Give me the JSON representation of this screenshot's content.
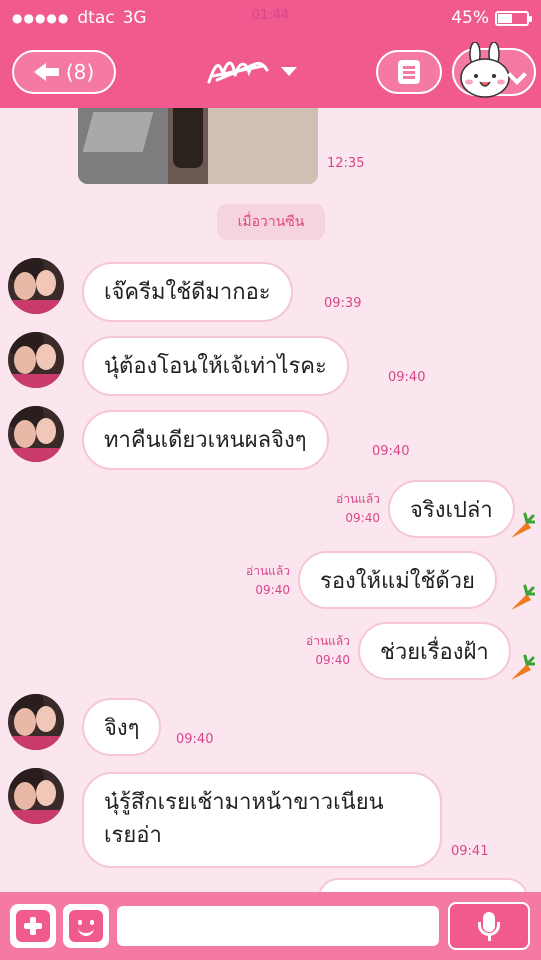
{
  "status_bar": {
    "carrier": "dtac",
    "network": "3G",
    "time": "01:44",
    "battery_percent": "45%",
    "battery_level": 0.45
  },
  "header": {
    "unread_count": "(8)",
    "icons": [
      "back-arrow-icon",
      "menu-icon",
      "bunny-avatar-icon"
    ]
  },
  "photo_message": {
    "time": "12:35"
  },
  "date_separator": "เมื่อวานซืน",
  "read_label": "อ่านแล้ว",
  "messages": [
    {
      "direction": "in",
      "text": "เจ๊ครีมใช้ดีมากอะ",
      "time": "09:39"
    },
    {
      "direction": "in",
      "text": "นุ๋ต้องโอนให้เจ้เท่าไรคะ",
      "time": "09:40"
    },
    {
      "direction": "in",
      "text": "ทาคืนเดียวเหนผลจิงๆ",
      "time": "09:40"
    },
    {
      "direction": "out",
      "text": "จริงเปล่า",
      "time": "09:40"
    },
    {
      "direction": "out",
      "text": "รองให้แม่ใช้ด้วย",
      "time": "09:40"
    },
    {
      "direction": "out",
      "text": "ช่วยเรื่องฝ้า",
      "time": "09:40"
    },
    {
      "direction": "in",
      "text": "จิงๆ",
      "time": "09:40"
    },
    {
      "direction": "in",
      "text_line1": "นุ๋รู้สึกเรยเช้ามาหน้าขาวเนียน",
      "text_line2": "เรยอ่า",
      "time": "09:41"
    }
  ],
  "colors": {
    "accent": "#f05a8f",
    "background": "#fbe6ef",
    "timestamp": "#d8468a"
  }
}
